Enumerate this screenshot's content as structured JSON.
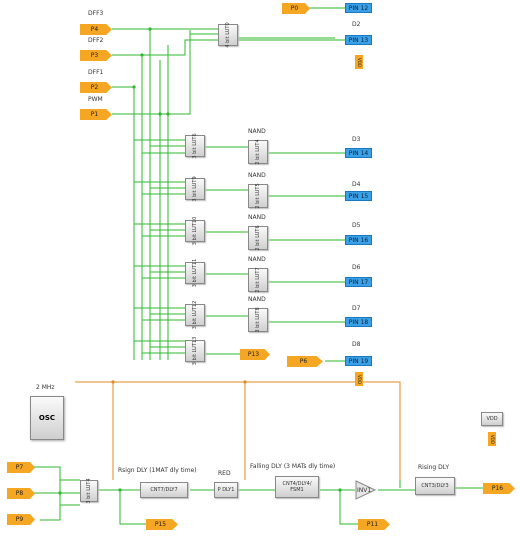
{
  "inputs": {
    "p4": {
      "port": "P4",
      "name": "DFF3"
    },
    "p3": {
      "port": "P3",
      "name": "DFF2"
    },
    "p2": {
      "port": "P2",
      "name": "DFF1"
    },
    "p1": {
      "port": "P1",
      "name": "PWM"
    },
    "p0": {
      "port": "P0"
    },
    "p6": {
      "port": "P6"
    },
    "p7": {
      "port": "P7"
    },
    "p8": {
      "port": "P8"
    },
    "p9": {
      "port": "P9"
    }
  },
  "pins": {
    "pin12": {
      "label": "PIN 12"
    },
    "pin13": {
      "label": "PIN 13",
      "name": "D2"
    },
    "pin14": {
      "label": "PIN 14",
      "name": "D3"
    },
    "pin15": {
      "label": "PIN 15",
      "name": "D4"
    },
    "pin16": {
      "label": "PIN 16",
      "name": "D5"
    },
    "pin17": {
      "label": "PIN 17",
      "name": "D6"
    },
    "pin18": {
      "label": "PIN 18",
      "name": "D7"
    },
    "pin19": {
      "label": "PIN 19",
      "name": "D8"
    }
  },
  "luts": {
    "top": "4 bit LUT0",
    "lut3_6": "3 bit LUT6",
    "lut3_9": "3 bit LUT9",
    "lut3_10": "3 bit LUT10",
    "lut3_11": "3 bit LUT11",
    "lut3_12": "3 bit LUT12",
    "lut3_13": "3 bit LUT13",
    "nand1": "2 bit LUT4",
    "nand2": "2 bit LUT5",
    "nand3": "2 bit LUT6",
    "nand4": "2 bit LUT7",
    "nand5": "3 bit LUT8",
    "bottom": "3 bit LUT4"
  },
  "nand_label": "NAND",
  "outputs": {
    "p13": "P13",
    "p15": "P15",
    "p11": "P11",
    "p16": "P16"
  },
  "osc": {
    "label": "OSC",
    "freq": "2 MHz"
  },
  "delays": {
    "rising_label": "Rsign DLY (1MAT dly time)",
    "cnt7": "CNT7/DLY7",
    "red_label": "RED",
    "pdly": "P DLY1",
    "falling_label": "Falling DLY (3 MATs dly time)",
    "cnt4": "CNT4/DLY4/ FSM1",
    "inv": "INV1",
    "rising2_label": "Rising DLY",
    "cnt3": "CNT3/DLY3"
  },
  "vdd": {
    "label": "VDD",
    "tag": "VDD"
  },
  "colors": {
    "wire": "#2db82d",
    "clock": "#e08a1e",
    "port": "#f5a623",
    "pin": "#3aa0e8"
  }
}
